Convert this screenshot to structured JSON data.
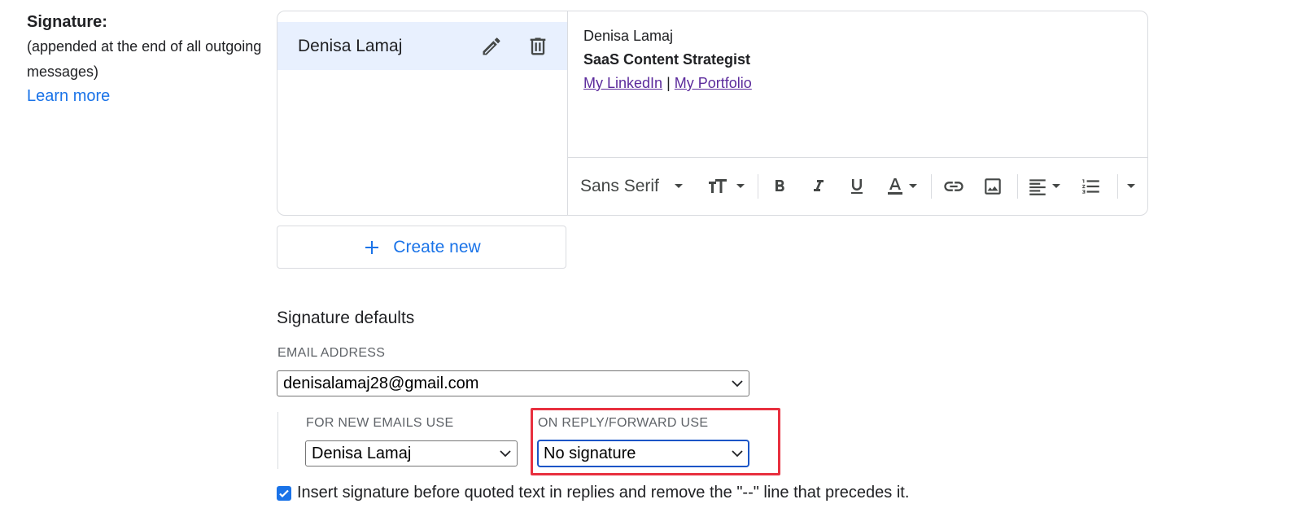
{
  "signature_section": {
    "title": "Signature:",
    "description": "(appended at the end of all outgoing messages)",
    "learn_more": "Learn more"
  },
  "signatures": [
    {
      "name": "Denisa Lamaj",
      "selected": true
    }
  ],
  "editor": {
    "line1": "Denisa Lamaj",
    "line2": "SaaS Content Strategist",
    "link1": "My LinkedIn",
    "separator": "|",
    "link2": "My Portfolio",
    "font": "Sans Serif"
  },
  "create_new": "Create new",
  "defaults": {
    "title": "Signature defaults",
    "email_label": "EMAIL ADDRESS",
    "email_value": "denisalamaj28@gmail.com",
    "new_label": "FOR NEW EMAILS USE",
    "new_value": "Denisa Lamaj",
    "reply_label": "ON REPLY/FORWARD USE",
    "reply_value": "No signature"
  },
  "insert_option": {
    "checked": true,
    "label": "Insert signature before quoted text in replies and remove the \"--\" line that precedes it."
  },
  "colors": {
    "accent": "#1a73e8",
    "selected_bg": "#e8f0fe",
    "highlight": "#e8303f",
    "visited_link": "#5b2a9c"
  }
}
